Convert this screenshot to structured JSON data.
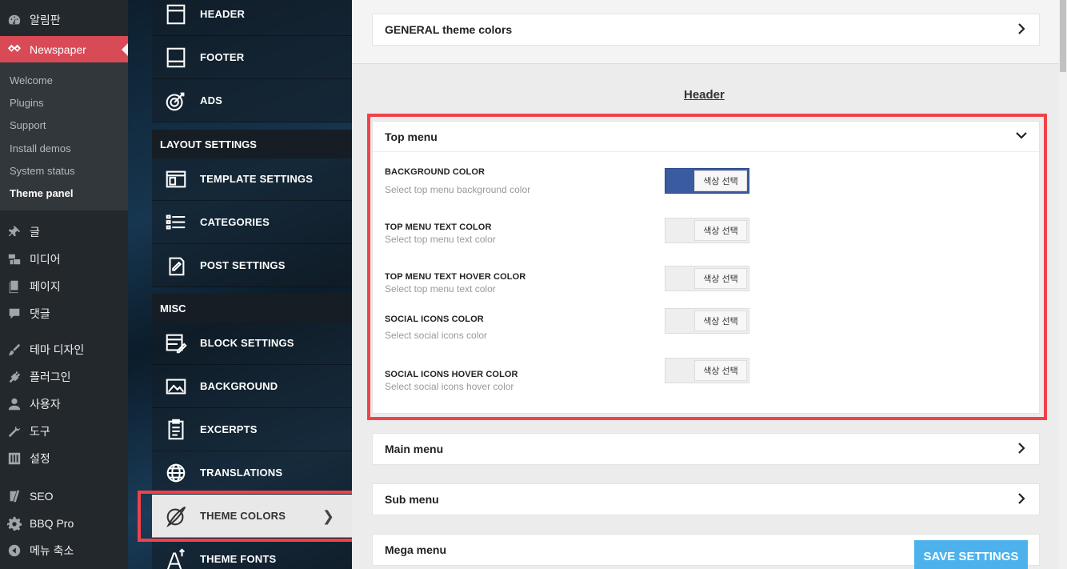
{
  "wp_menu": {
    "dashboard": "알림판",
    "newspaper": "Newspaper",
    "submenu": [
      "Welcome",
      "Plugins",
      "Support",
      "Install demos",
      "System status",
      "Theme panel"
    ],
    "posts": "글",
    "media": "미디어",
    "pages": "페이지",
    "comments": "댓글",
    "appearance": "테마 디자인",
    "plugins": "플러그인",
    "users": "사용자",
    "tools": "도구",
    "settings": "설정",
    "seo": "SEO",
    "bbq": "BBQ Pro",
    "collapse": "메뉴 축소"
  },
  "theme_nav": {
    "header": "HEADER",
    "footer": "FOOTER",
    "ads": "ADS",
    "layout_section": "LAYOUT SETTINGS",
    "template": "TEMPLATE SETTINGS",
    "categories": "CATEGORIES",
    "post": "POST SETTINGS",
    "misc_section": "MISC",
    "block": "BLOCK SETTINGS",
    "background": "BACKGROUND",
    "excerpts": "EXCERPTS",
    "translations": "TRANSLATIONS",
    "theme_colors": "THEME COLORS",
    "theme_fonts": "THEME FONTS"
  },
  "content": {
    "general_panel": "GENERAL theme colors",
    "section_title": "Header",
    "top_menu": {
      "title": "Top menu",
      "options": [
        {
          "title": "BACKGROUND COLOR",
          "desc": "Select top menu background color",
          "button": "색상 선택",
          "color": "#3a5ba0"
        },
        {
          "title": "TOP MENU TEXT COLOR",
          "desc": "Select top menu text color",
          "button": "색상 선택",
          "color": ""
        },
        {
          "title": "TOP MENU TEXT HOVER COLOR",
          "desc": "Select top menu text color",
          "button": "색상 선택",
          "color": ""
        },
        {
          "title": "SOCIAL ICONS COLOR",
          "desc": "Select social icons color",
          "button": "색상 선택",
          "color": ""
        },
        {
          "title": "SOCIAL ICONS HOVER COLOR",
          "desc": "Select social icons hover color",
          "button": "색상 선택",
          "color": ""
        }
      ]
    },
    "main_menu": "Main menu",
    "sub_menu": "Sub menu",
    "mega_menu": "Mega menu",
    "save": "SAVE SETTINGS"
  },
  "colors": {
    "accent_red": "#f0424b",
    "wp_active": "#d94a57",
    "save_blue": "#4db2ec"
  }
}
